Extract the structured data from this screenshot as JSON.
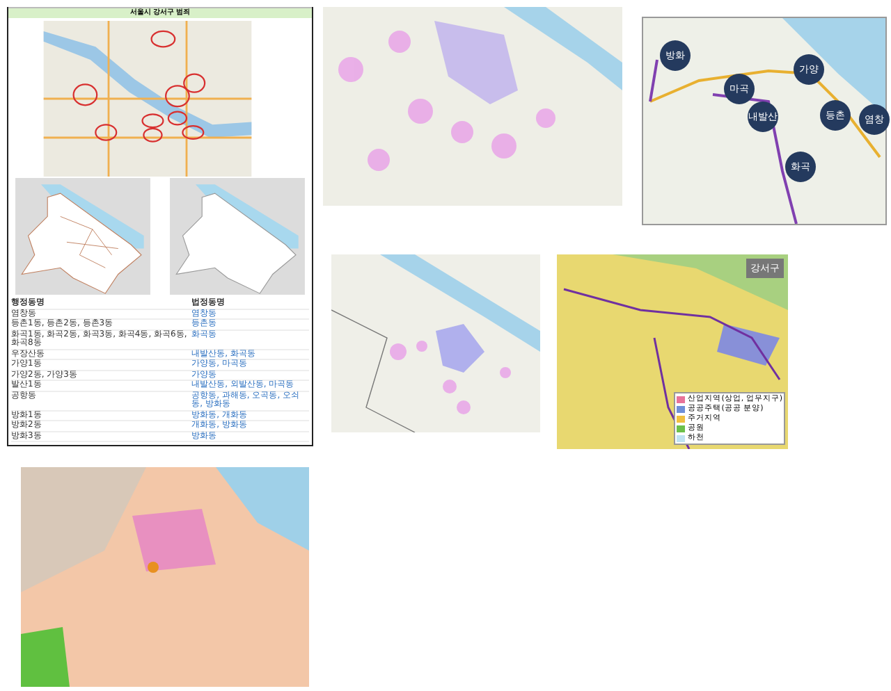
{
  "district_panel": {
    "title": "서울시 강서구 범죄",
    "table": {
      "columns": [
        "행정동명",
        "법정동명"
      ],
      "rows": [
        [
          "염창동",
          "염창동"
        ],
        [
          "등촌1동, 등촌2동, 등촌3동",
          "등촌동"
        ],
        [
          "화곡1동, 화곡2동, 화곡3동, 화곡4동, 화곡6동, 화곡8동",
          "화곡동"
        ],
        [
          "우장산동",
          "내발산동, 화곡동"
        ],
        [
          "가양1동",
          "가양동, 마곡동"
        ],
        [
          "가양2동, 가양3동",
          "가양동"
        ],
        [
          "발산1동",
          "내발산동, 외발산동, 마곡동"
        ],
        [
          "공항동",
          "공항동, 과해동, 오곡동, 오쇠동, 방화동"
        ],
        [
          "방화1동",
          "방화동, 개화동"
        ],
        [
          "방화2동",
          "개화동, 방화동"
        ],
        [
          "방화3동",
          "방화동"
        ]
      ]
    }
  },
  "station_map": {
    "areas": [
      "방화",
      "마곡",
      "가양",
      "내발산",
      "등촌",
      "염창",
      "화곡"
    ]
  },
  "plan_map": {
    "title": "강서구",
    "legend": [
      {
        "label": "산업지역(상업, 업무지구)",
        "color": "#e8739a"
      },
      {
        "label": "공공주택(공공 분양)",
        "color": "#6f8fd8"
      },
      {
        "label": "주거지역",
        "color": "#f0c040"
      },
      {
        "label": "공원",
        "color": "#6cc04a"
      },
      {
        "label": "하천",
        "color": "#bfe3f2"
      }
    ]
  }
}
